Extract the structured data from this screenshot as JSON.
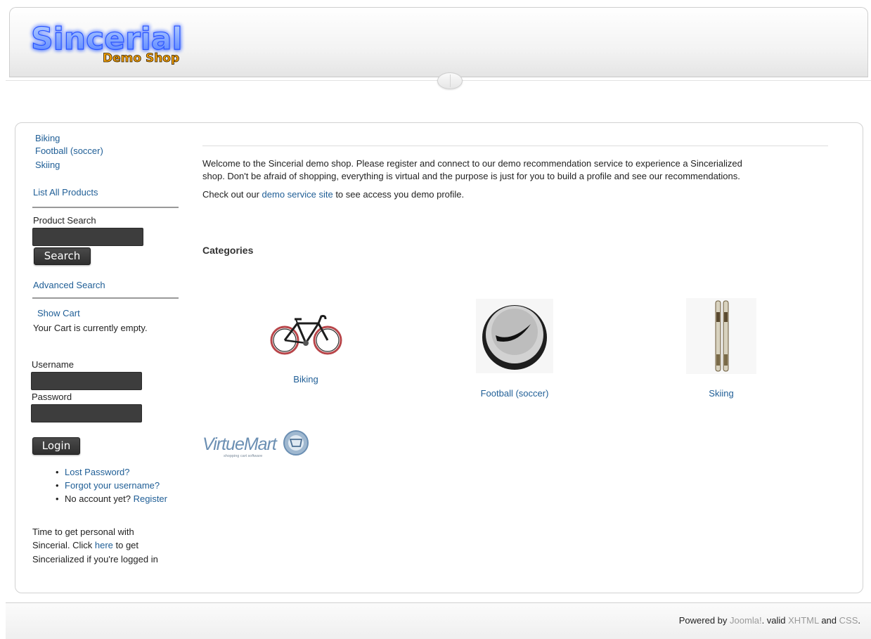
{
  "header": {
    "logo_main": "Sincerial",
    "logo_sub": "Demo Shop"
  },
  "sidebar": {
    "categories": [
      "Biking",
      "Football (soccer)",
      "Skiing"
    ],
    "list_all": "List All Products",
    "search_label": "Product Search",
    "search_value": "",
    "search_button": "Search",
    "advanced_search": "Advanced Search",
    "show_cart": "Show Cart",
    "cart_status": "Your Cart is currently empty.",
    "username_label": "Username",
    "password_label": "Password",
    "username_value": "",
    "password_value": "",
    "login_button": "Login",
    "lost_password": "Lost Password?",
    "forgot_username": "Forgot your username?",
    "no_account": "No account yet?",
    "register": "Register",
    "promo_line1": "Time to get personal with",
    "promo_line2_pre": "Sincerial. Click ",
    "promo_here": "here",
    "promo_line2_post": " to get",
    "promo_line3": "Sincerialized if you're logged in"
  },
  "main": {
    "welcome_line1": "Welcome to the Sincerial demo shop. Please register and connect to our demo recommendation service to experience a Sincerialized",
    "welcome_line2": "shop. Don't be afraid of shopping, everything is virtual and the purpose is just for you to build a profile and see our recommendations.",
    "checkout_pre": "Check out our ",
    "checkout_link": "demo service site",
    "checkout_post": " to see access you demo profile.",
    "categories_heading": "Categories",
    "categories": [
      {
        "label": "Biking",
        "icon": "bicycle-icon"
      },
      {
        "label": "Football (soccer)",
        "icon": "soccer-ball-icon"
      },
      {
        "label": "Skiing",
        "icon": "skis-icon"
      }
    ],
    "virtuemart_logo": "VirtueMart",
    "virtuemart_tagline": "shopping cart software"
  },
  "footer": {
    "powered_by": "Powered by ",
    "joomla": "Joomla!",
    "valid": ". valid ",
    "xhtml": "XHTML",
    "and": " and ",
    "css": "CSS",
    "period": "."
  },
  "colors": {
    "link": "#1f5e96",
    "logo_glow": "#3a6cff",
    "logo_sub": "#f5a000",
    "input_dark": "#3d3d3d"
  }
}
